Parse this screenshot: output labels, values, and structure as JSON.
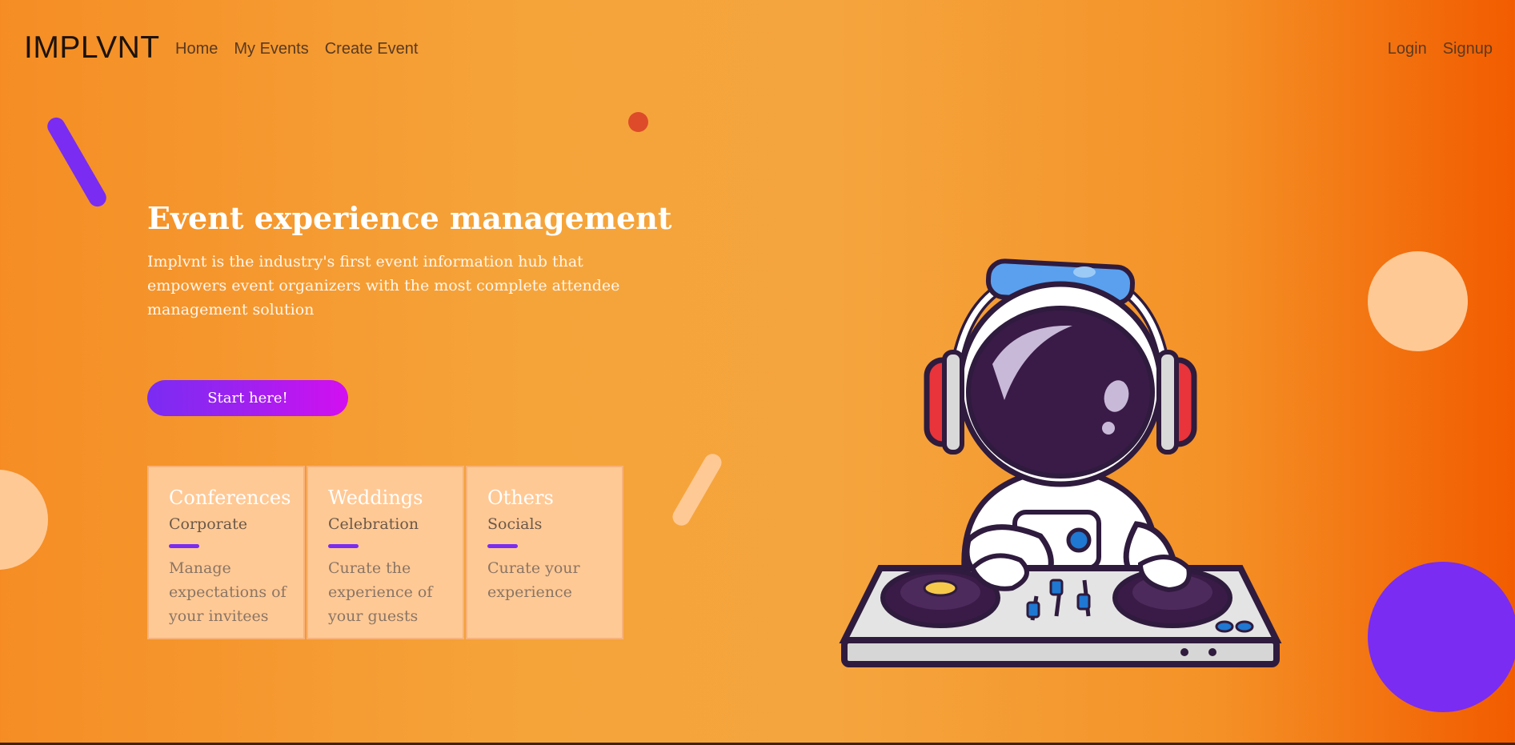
{
  "navbar": {
    "brand": "IMPLVNT",
    "left_links": [
      "Home",
      "My Events",
      "Create Event"
    ],
    "right_links": [
      "Login",
      "Signup"
    ]
  },
  "hero": {
    "title": "Event experience management",
    "description": "Implvnt is the industry's first event information hub that empowers event organizers with the most complete attendee management solution",
    "cta_label": "Start here!"
  },
  "cards": [
    {
      "title": "Conferences",
      "subtitle": "Corporate",
      "text": "Manage expectations of your invitees"
    },
    {
      "title": "Weddings",
      "subtitle": "Celebration",
      "text": "Curate the experience of your guests"
    },
    {
      "title": "Others",
      "subtitle": "Socials",
      "text": "Curate your experience"
    }
  ],
  "colors": {
    "accent_purple": "#7a2cf2",
    "peach": "#ffc995",
    "orange_light": "#f5a53e",
    "orange_dark": "#f25c00"
  },
  "illustration": "astronaut-dj-illustration"
}
